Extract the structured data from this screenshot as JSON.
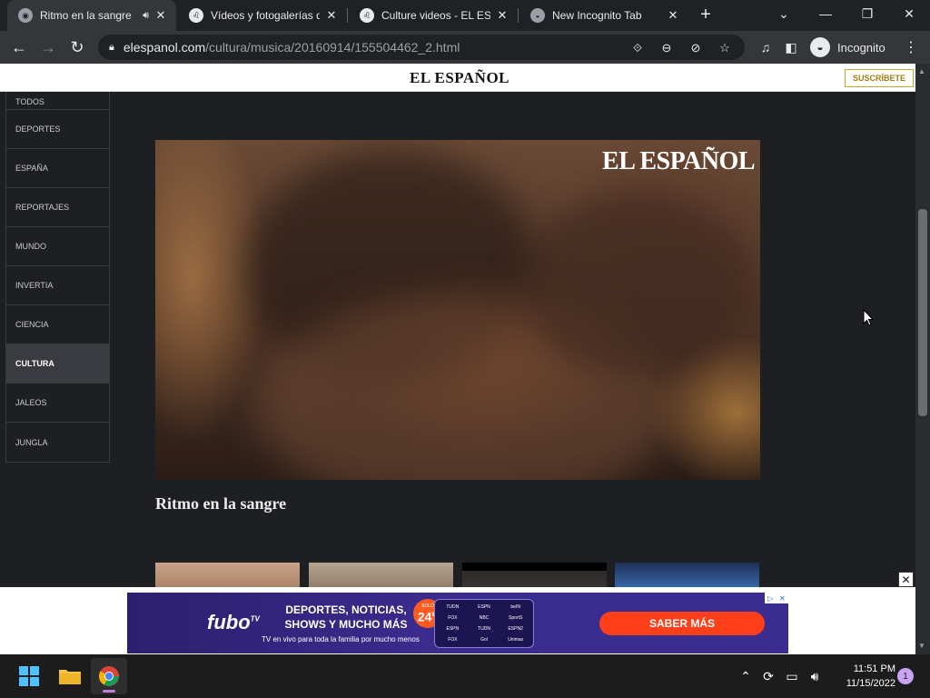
{
  "browser": {
    "tabs": [
      {
        "title": "Ritmo en la sangre",
        "active": true,
        "favicon": "chrome-globe-icon",
        "playing_audio": true
      },
      {
        "title": "Vídeos y fotogalerías d",
        "active": false,
        "favicon": "el-espanol-lion-icon"
      },
      {
        "title": "Culture videos - EL ESP",
        "active": false,
        "favicon": "el-espanol-lion-icon"
      },
      {
        "title": "New Incognito Tab",
        "active": false,
        "favicon": "incognito-icon"
      }
    ],
    "url_domain": "elespanol.com",
    "url_path": "/cultura/musica/20160914/155504462_2.html",
    "profile_label": "Incognito"
  },
  "site": {
    "logo": "EL ESPAÑOL",
    "subscribe_label": "SUSCRÍBETE",
    "nav": [
      "TODOS",
      "DEPORTES",
      "ESPAÑA",
      "REPORTAJES",
      "MUNDO",
      "INVERTIA",
      "CIENCIA",
      "CULTURA",
      "JALEOS",
      "JUNGLA"
    ],
    "active_nav": "CULTURA",
    "video_watermark": "EL ESPAÑOL",
    "video_title": "Ritmo en la sangre"
  },
  "ad": {
    "brand": "fubo",
    "brand_sup": "TV",
    "headline": "DEPORTES, NOTICIAS, SHOWS Y MUCHO MÁS",
    "subline": "TV en vivo para toda la familia por mucho menos",
    "badge_small": "SOLO",
    "badge_value": "24",
    "badge_unit": "99",
    "channels": [
      "TUDN",
      "ESPN",
      "beIN",
      "FOX",
      "NBC",
      "SportS",
      "ESPN",
      "TUDN",
      "ESPN2",
      "FOX",
      "Gol",
      "Unimas"
    ],
    "cta": "SABER MÁS"
  },
  "taskbar": {
    "time": "11:51 PM",
    "date": "11/15/2022",
    "notification_count": "1"
  },
  "colors": {
    "page_bg": "#1e1f23",
    "browser_frame": "#202124",
    "toolbar": "#35363a",
    "ad_purple": "#3a2b8d",
    "ad_cta": "#ff3e1a",
    "subscribe_gold": "#c9a227"
  }
}
